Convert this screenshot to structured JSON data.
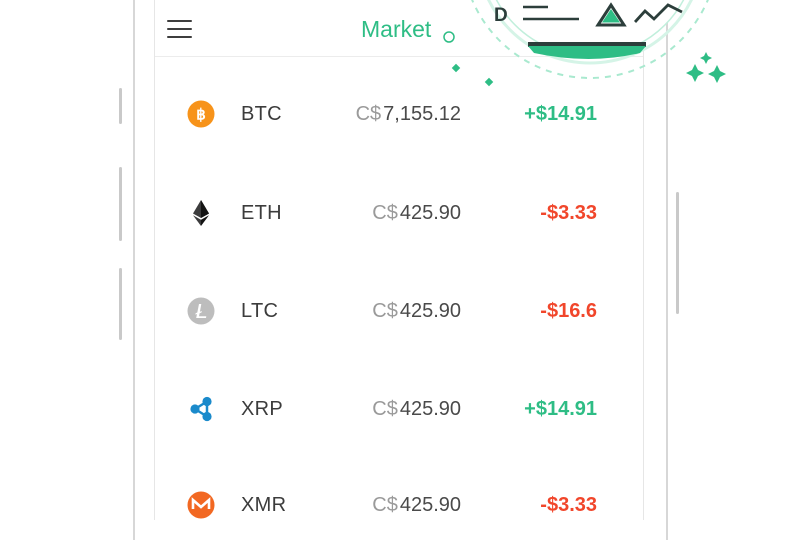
{
  "header": {
    "title": "Market"
  },
  "illustration": {
    "letter": "D"
  },
  "colors": {
    "accent": "#2ebd85",
    "negative": "#f1462b",
    "btc": "#f7931a",
    "eth": "#3c3c3d",
    "ltc": "#bdbdbd",
    "xrp": "#1a8acb",
    "xmr": "#f26822"
  },
  "coins": [
    {
      "symbol": "BTC",
      "currency": "C$",
      "price": "7,155.12",
      "change": "+$14.91",
      "trend": "up",
      "icon": "bitcoin-icon"
    },
    {
      "symbol": "ETH",
      "currency": "C$",
      "price": "425.90",
      "change": "-$3.33",
      "trend": "down",
      "icon": "ethereum-icon"
    },
    {
      "symbol": "LTC",
      "currency": "C$",
      "price": "425.90",
      "change": "-$16.6",
      "trend": "down",
      "icon": "litecoin-icon"
    },
    {
      "symbol": "XRP",
      "currency": "C$",
      "price": "425.90",
      "change": "+$14.91",
      "trend": "up",
      "icon": "ripple-icon"
    },
    {
      "symbol": "XMR",
      "currency": "C$",
      "price": "425.90",
      "change": "-$3.33",
      "trend": "down",
      "icon": "monero-icon"
    }
  ]
}
